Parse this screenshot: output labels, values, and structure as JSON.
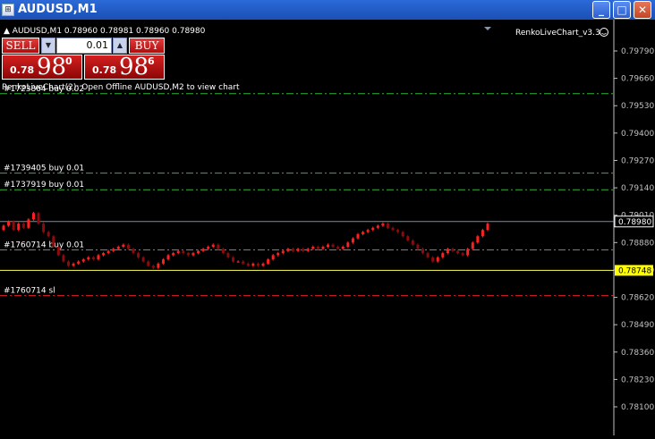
{
  "window": {
    "title": "AUDUSD,M1",
    "app_icon": "chart-window-icon",
    "buttons": {
      "minimize": "_",
      "maximize": "□",
      "close": "✕"
    }
  },
  "chart": {
    "header": "▲ AUDUSD,M1  0.78960 0.78981 0.78960 0.78980",
    "indicator_label": "RenkoLiveChart_v3.3",
    "indicator_icon": "smiley-icon",
    "notice": "RenkoLiveChart(2): Open Offline AUDUSD,M2 to view chart",
    "price_axis": [
      "0.79790",
      "0.79660",
      "0.79530",
      "0.79400",
      "0.79270",
      "0.79140",
      "0.79010",
      "0.78880",
      "0.78750",
      "0.78620",
      "0.78490",
      "0.78360",
      "0.78230",
      "0.78100"
    ],
    "bid_tag": "0.78980",
    "ask_tag": "0.78748",
    "order_lines": [
      {
        "label": "#1723864 buy 0.02",
        "price": 0.79587,
        "color": "#2fb62f"
      },
      {
        "label": "#1739405 buy 0.01",
        "price": 0.7921,
        "color": "#2fb62f"
      },
      {
        "label": "#1737919 buy 0.01",
        "price": 0.79131,
        "color": "#2fb62f"
      },
      {
        "label": "#1760714 buy 0.01",
        "price": 0.78845,
        "color": "#2fb62f"
      },
      {
        "label": "#1760714 sl",
        "price": 0.78628,
        "color": "#e02020"
      }
    ],
    "bid_price": 0.7898,
    "ask_price": 0.78748,
    "colors": {
      "up_candle": "#ff2020",
      "down_candle": "#8a0c0c",
      "bid_line": "#7a8aa8",
      "ask_line": "#ffff60",
      "tag_bg": "#ffff00",
      "bid_tag_bg": "#000000"
    },
    "candles_close": [
      0.7896,
      0.7898,
      0.7894,
      0.7897,
      0.7895,
      0.7899,
      0.7902,
      0.7897,
      0.7893,
      0.7891,
      0.7886,
      0.7882,
      0.7879,
      0.7877,
      0.7878,
      0.7879,
      0.788,
      0.7881,
      0.788,
      0.7882,
      0.7883,
      0.7884,
      0.7885,
      0.7886,
      0.7887,
      0.7885,
      0.7883,
      0.7881,
      0.7879,
      0.7877,
      0.7876,
      0.7878,
      0.788,
      0.7882,
      0.7883,
      0.7884,
      0.7883,
      0.7882,
      0.7883,
      0.7884,
      0.7885,
      0.7886,
      0.7887,
      0.7885,
      0.7883,
      0.7881,
      0.7879,
      0.7879,
      0.7878,
      0.7877,
      0.7878,
      0.7877,
      0.7878,
      0.788,
      0.7882,
      0.7883,
      0.7884,
      0.7885,
      0.7884,
      0.7885,
      0.7884,
      0.7885,
      0.7886,
      0.7885,
      0.7886,
      0.7887,
      0.7886,
      0.7885,
      0.7886,
      0.7888,
      0.789,
      0.7892,
      0.7893,
      0.7894,
      0.7895,
      0.7896,
      0.7897,
      0.7895,
      0.7894,
      0.7893,
      0.7891,
      0.7889,
      0.7887,
      0.7885,
      0.7883,
      0.7881,
      0.7879,
      0.7881,
      0.7883,
      0.7885,
      0.7884,
      0.7883,
      0.7882,
      0.7885,
      0.7888,
      0.7891,
      0.7894,
      0.7897
    ]
  },
  "trade_panel": {
    "sell_label": "SELL",
    "buy_label": "BUY",
    "lot": "0.01",
    "lot_down_icon": "down-arrow-icon",
    "lot_up_icon": "up-arrow-icon",
    "sell_prefix": "0.78",
    "sell_big": "98",
    "sell_sup": "0",
    "buy_prefix": "0.78",
    "buy_big": "98",
    "buy_sup": "6"
  }
}
